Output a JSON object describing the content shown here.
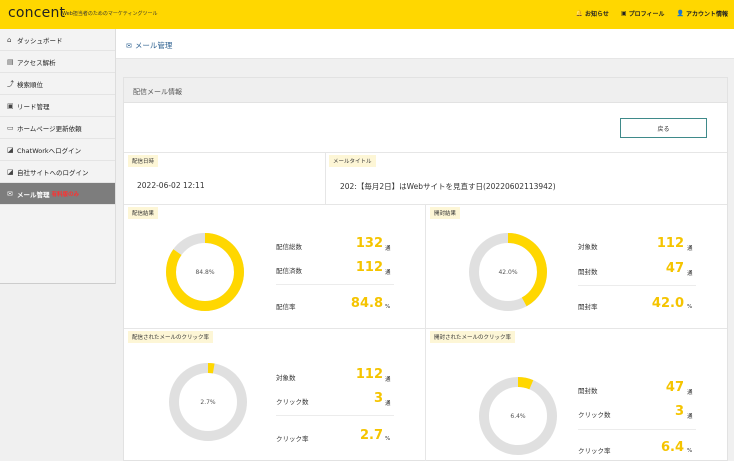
{
  "header": {
    "logo": "concent",
    "tagline": "Web担当者のためのマーケティングツール",
    "nav": [
      {
        "icon": "bell-icon",
        "glyph": "🔔",
        "label": "お知らせ"
      },
      {
        "icon": "profile-card-icon",
        "glyph": "▣",
        "label": "プロフィール"
      },
      {
        "icon": "user-icon",
        "glyph": "👤",
        "label": "アカウント情報"
      }
    ]
  },
  "sidebar": {
    "items": [
      {
        "icon": "dashboard-icon",
        "glyph": "⌂",
        "label": "ダッシュボード",
        "note": ""
      },
      {
        "icon": "chart-icon",
        "glyph": "▤",
        "label": "アクセス解析",
        "note": ""
      },
      {
        "icon": "ranking-icon",
        "glyph": "⤴",
        "label": "検索順位",
        "note": ""
      },
      {
        "icon": "lead-icon",
        "glyph": "▣",
        "label": "リード管理",
        "note": ""
      },
      {
        "icon": "monitor-icon",
        "glyph": "▭",
        "label": "ホームページ更新依頼",
        "note": ""
      },
      {
        "icon": "external-link-icon",
        "glyph": "◪",
        "label": "ChatWorkへログイン",
        "note": ""
      },
      {
        "icon": "external-link-icon",
        "glyph": "◪",
        "label": "自社サイトへのログイン",
        "note": ""
      },
      {
        "icon": "mail-icon",
        "glyph": "✉",
        "label": "メール管理",
        "note": "有料版のみ"
      }
    ]
  },
  "page": {
    "title": "メール管理",
    "title_icon": "✉",
    "card_title": "配信メール情報",
    "back_label": "戻る"
  },
  "delivery": {
    "date_label": "配信日時",
    "date_value": "2022-06-02 12:11",
    "mail_title_label": "メールタイトル",
    "mail_title_value": "202:【毎月2日】はWebサイトを見直す日(20220602113942)"
  },
  "panels": [
    {
      "title": "配信結果",
      "chart_label": "84.8%",
      "fraction": 0.848,
      "stats": [
        {
          "label": "配信総数",
          "value": "132",
          "unit": "通"
        },
        {
          "label": "配信済数",
          "value": "112",
          "unit": "通"
        },
        {
          "label": "配信率",
          "value": "84.8",
          "unit": "%"
        }
      ]
    },
    {
      "title": "開封結果",
      "chart_label": "42.0%",
      "fraction": 0.42,
      "stats": [
        {
          "label": "対象数",
          "value": "112",
          "unit": "通"
        },
        {
          "label": "開封数",
          "value": "47",
          "unit": "通"
        },
        {
          "label": "開封率",
          "value": "42.0",
          "unit": "%"
        }
      ]
    },
    {
      "title": "配信されたメールのクリック率",
      "chart_label": "2.7%",
      "fraction": 0.027,
      "stats": [
        {
          "label": "対象数",
          "value": "112",
          "unit": "通"
        },
        {
          "label": "クリック数",
          "value": "3",
          "unit": "通"
        },
        {
          "label": "クリック率",
          "value": "2.7",
          "unit": "%"
        }
      ]
    },
    {
      "title": "開封されたメールのクリック率",
      "chart_label": "6.4%",
      "fraction": 0.064,
      "stats": [
        {
          "label": "開封数",
          "value": "47",
          "unit": "通"
        },
        {
          "label": "クリック数",
          "value": "3",
          "unit": "通"
        },
        {
          "label": "クリック率",
          "value": "6.4",
          "unit": "%"
        }
      ]
    }
  ],
  "colors": {
    "brand_yellow": "#ffd700",
    "donut_fill": "#ffd700",
    "donut_track": "#e0e0e0",
    "stat_number": "#f5c400",
    "active_sidebar": "#7d7d7d",
    "title_blue": "#2b5f8f"
  }
}
